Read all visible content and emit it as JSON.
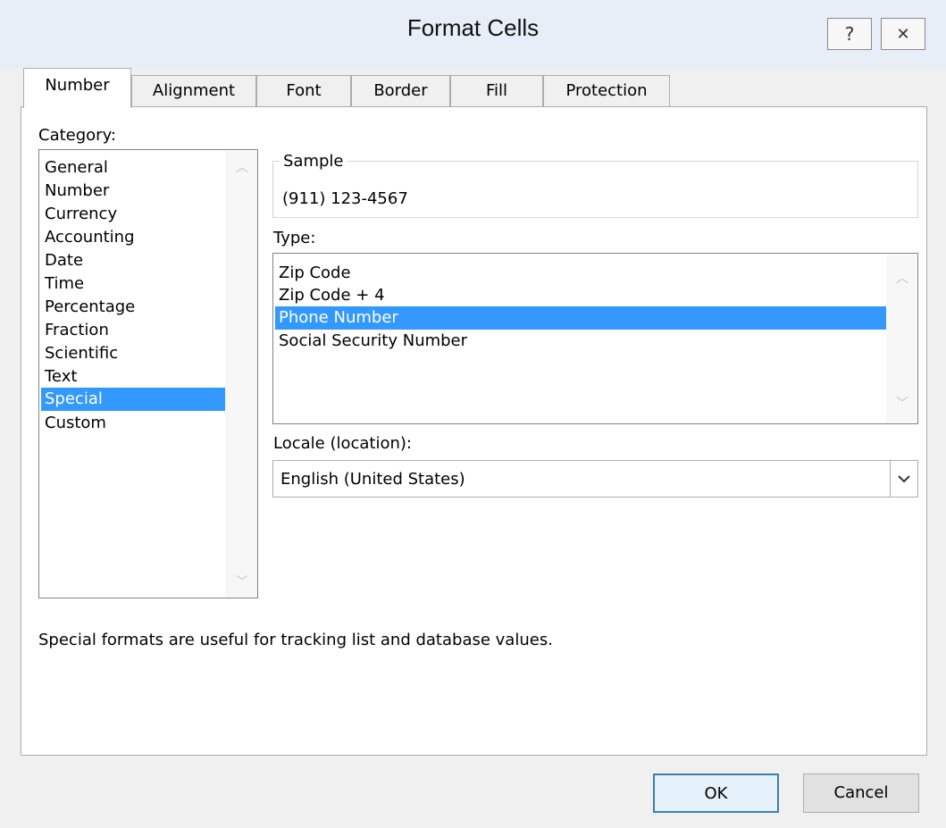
{
  "window": {
    "title": "Format Cells",
    "help_symbol": "?",
    "close_symbol": "✕"
  },
  "tabs": [
    "Number",
    "Alignment",
    "Font",
    "Border",
    "Fill",
    "Protection"
  ],
  "category": {
    "label": "Category:",
    "items": [
      "General",
      "Number",
      "Currency",
      "Accounting",
      "Date",
      "Time",
      "Percentage",
      "Fraction",
      "Scientific",
      "Text",
      "Special",
      "Custom"
    ],
    "selected": "Special"
  },
  "sample": {
    "label": "Sample",
    "value": "(911) 123-4567"
  },
  "type": {
    "label": "Type:",
    "items": [
      "Zip Code",
      "Zip Code + 4",
      "Phone Number",
      "Social Security Number"
    ],
    "selected": "Phone Number"
  },
  "locale": {
    "label": "Locale (location):",
    "value": "English (United States)"
  },
  "description": "Special formats are useful for tracking list and database values.",
  "buttons": {
    "ok": "OK",
    "cancel": "Cancel"
  },
  "colors": {
    "selection": "#3399ff",
    "titlebar": "#e8eef7",
    "dialog_bg": "#f0f0f0"
  }
}
